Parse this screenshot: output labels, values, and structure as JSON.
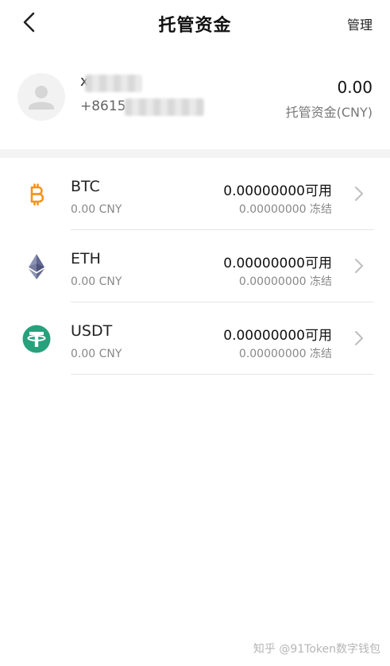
{
  "header": {
    "title": "托管资金",
    "manage_label": "管理",
    "back_icon": "chevron-left-icon"
  },
  "account": {
    "name": "x",
    "phone": "+8615",
    "total_amount": "0.00",
    "total_label": "托管资金(CNY)",
    "avatar_icon": "user-avatar-icon"
  },
  "assets": [
    {
      "symbol": "BTC",
      "cny": "0.00 CNY",
      "available": "0.00000000可用",
      "frozen": "0.00000000 冻结",
      "icon": "bitcoin-icon",
      "color": "#F7931A"
    },
    {
      "symbol": "ETH",
      "cny": "0.00 CNY",
      "available": "0.00000000可用",
      "frozen": "0.00000000 冻结",
      "icon": "ethereum-icon",
      "color": "#3C3C3D"
    },
    {
      "symbol": "USDT",
      "cny": "0.00 CNY",
      "available": "0.00000000可用",
      "frozen": "0.00000000 冻结",
      "icon": "tether-icon",
      "color": "#26A17B"
    }
  ],
  "watermark": "知乎 @91Token数字钱包"
}
